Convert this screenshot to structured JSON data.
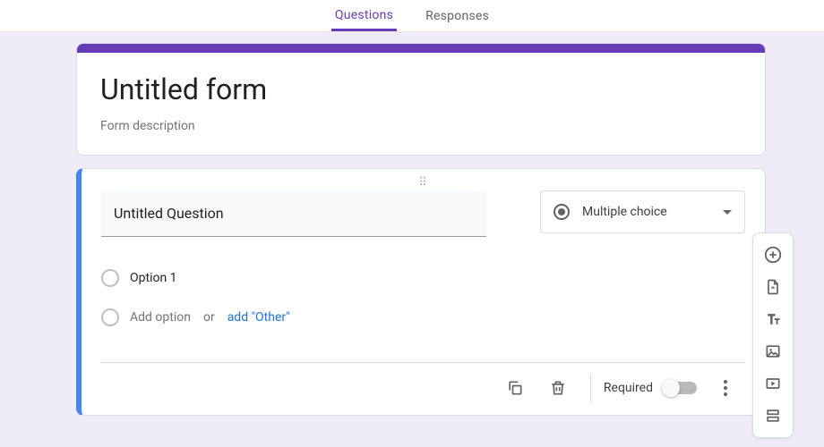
{
  "tabs": {
    "questions": "Questions",
    "responses": "Responses",
    "active": "questions"
  },
  "header": {
    "title": "Untitled form",
    "description": "Form description"
  },
  "question": {
    "text": "Untitled Question",
    "type_label": "Multiple choice",
    "options": [
      {
        "label": "Option 1"
      }
    ],
    "add_option_text": "Add option",
    "or_text": "or",
    "add_other_text": "add \"Other\""
  },
  "footer": {
    "required_label": "Required",
    "required_on": false
  },
  "side_toolbar": {
    "items": [
      "add-question",
      "import-questions",
      "add-title",
      "add-image",
      "add-video",
      "add-section"
    ]
  },
  "colors": {
    "accent": "#673ab7",
    "selection": "#4285f4",
    "link": "#1a73e8"
  }
}
